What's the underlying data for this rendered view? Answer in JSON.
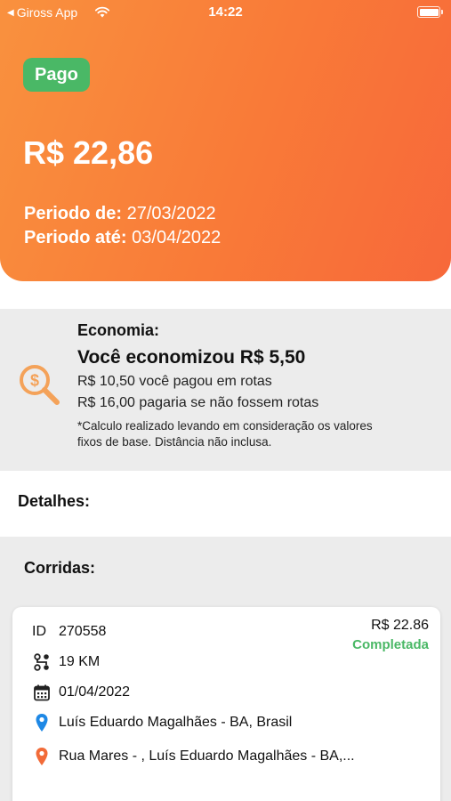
{
  "status_bar": {
    "back_app": "Giross App",
    "time": "14:22"
  },
  "header": {
    "badge": "Pago",
    "amount": "R$ 22,86",
    "period_from_label": "Periodo de:",
    "period_from_value": "27/03/2022",
    "period_to_label": "Periodo até:",
    "period_to_value": "03/04/2022",
    "badge_color": "#4ab866",
    "gradient_colors": [
      "#f9913e",
      "#f7683a"
    ]
  },
  "savings": {
    "title": "Economia:",
    "headline": "Você economizou R$ 5,50",
    "paid_line": "R$ 10,50 você pagou em rotas",
    "would_pay_line": "R$ 16,00 pagaria se não fossem rotas",
    "note": "*Calculo realizado levando em consideração os valores fixos de base. Distância não inclusa.",
    "icon": "dollar-search-icon",
    "icon_color": "#f4a259"
  },
  "details": {
    "label": "Detalhes:"
  },
  "rides": {
    "label": "Corridas:",
    "items": [
      {
        "id_label": "ID",
        "id": "270558",
        "price": "R$ 22.86",
        "status": "Completada",
        "status_color": "#4ab866",
        "distance": "19 KM",
        "date": "01/04/2022",
        "origin": "Luís Eduardo Magalhães - BA, Brasil",
        "destination": "Rua Mares - , Luís Eduardo Magalhães - BA,...",
        "origin_pin_color": "#1e88e5",
        "destination_pin_color": "#f26b38"
      }
    ]
  }
}
